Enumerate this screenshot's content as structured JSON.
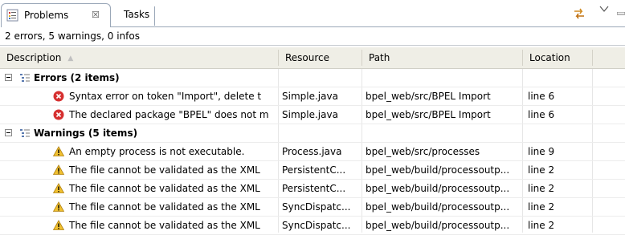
{
  "tabs": [
    {
      "label": "Problems",
      "close_glyph": "☒",
      "icon": "problems-view-icon",
      "active": true
    },
    {
      "label": "Tasks",
      "active": false
    }
  ],
  "toolbar": {
    "sync_icon": "sync-icon",
    "menu_icon": "view-menu-icon",
    "minimize_icon": "minimize-icon"
  },
  "summary": "2 errors, 5 warnings, 0 infos",
  "columns": {
    "description": "Description",
    "resource": "Resource",
    "path": "Path",
    "location": "Location",
    "sort_icon": "sort-ascending-icon"
  },
  "groups": [
    {
      "label": "Errors (2 items)",
      "type": "error",
      "items": [
        {
          "description": "Syntax error on token \"Import\", delete t",
          "resource": "Simple.java",
          "path": "bpel_web/src/BPEL Import",
          "location": "line 6"
        },
        {
          "description": "The declared package \"BPEL\" does not m",
          "resource": "Simple.java",
          "path": "bpel_web/src/BPEL Import",
          "location": "line 6"
        }
      ]
    },
    {
      "label": "Warnings (5 items)",
      "type": "warning",
      "items": [
        {
          "description": "An empty process is not executable.",
          "resource": "Process.java",
          "path": "bpel_web/src/processes",
          "location": "line 9"
        },
        {
          "description": "The file cannot be validated as the XML",
          "resource": "PersistentC...",
          "path": "bpel_web/build/processoutp...",
          "location": "line 2"
        },
        {
          "description": "The file cannot be validated as the XML",
          "resource": "PersistentC...",
          "path": "bpel_web/build/processoutp...",
          "location": "line 2"
        },
        {
          "description": "The file cannot be validated as the XML",
          "resource": "SyncDispatc...",
          "path": "bpel_web/build/processoutp...",
          "location": "line 2"
        },
        {
          "description": "The file cannot be validated as the XML",
          "resource": "SyncDispatc...",
          "path": "bpel_web/build/processoutp...",
          "location": "line 2"
        }
      ]
    }
  ],
  "colors": {
    "error": "#d63030",
    "warning": "#e8b020",
    "header_bg": "#efeee6",
    "tab_border": "#9aa7b8"
  }
}
